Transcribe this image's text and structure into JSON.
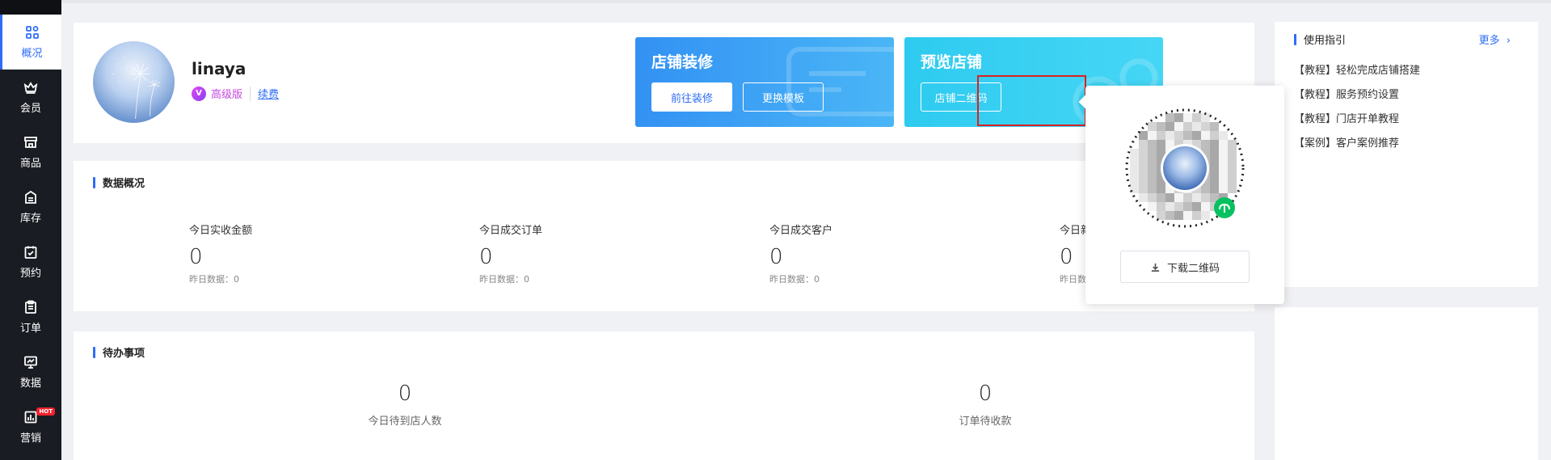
{
  "sidebar": {
    "items": [
      {
        "label": "概况",
        "icon": "overview-icon",
        "active": true
      },
      {
        "label": "会员",
        "icon": "crown-icon"
      },
      {
        "label": "商品",
        "icon": "store-icon"
      },
      {
        "label": "库存",
        "icon": "inventory-icon"
      },
      {
        "label": "预约",
        "icon": "calendar-check-icon"
      },
      {
        "label": "订单",
        "icon": "clipboard-icon"
      },
      {
        "label": "数据",
        "icon": "chart-monitor-icon"
      },
      {
        "label": "营销",
        "icon": "marketing-icon",
        "badge": "HOT"
      }
    ]
  },
  "shop": {
    "name": "linaya",
    "level_icon": "V",
    "level": "高级版",
    "renew": "续费"
  },
  "decorate": {
    "title": "店铺装修",
    "goto_btn": "前往装修",
    "template_btn": "更换模板"
  },
  "preview": {
    "title": "预览店铺",
    "qr_btn": "店铺二维码"
  },
  "overview": {
    "title": "数据概况",
    "stats": [
      {
        "label": "今日实收金额",
        "value": "0",
        "yesterday": "昨日数据：0"
      },
      {
        "label": "今日成交订单",
        "value": "0",
        "yesterday": "昨日数据：0"
      },
      {
        "label": "今日成交客户",
        "value": "0",
        "yesterday": "昨日数据：0"
      },
      {
        "label": "今日新",
        "value": "0",
        "yesterday": "昨日数据"
      }
    ]
  },
  "todo": {
    "title": "待办事项",
    "items": [
      {
        "value": "0",
        "label": "今日待到店人数"
      },
      {
        "value": "0",
        "label": "订单待收款"
      }
    ]
  },
  "guide": {
    "title": "使用指引",
    "more": "更多",
    "items": [
      "【教程】轻松完成店铺搭建",
      "【教程】服务预约设置",
      "【教程】门店开单教程",
      "【案例】客户案例推荐"
    ]
  },
  "popover": {
    "download_btn": "下载二维码"
  },
  "colors": {
    "primary": "#2f6df6",
    "sidebar_bg": "#1a1c23",
    "highlight": "#d9221f",
    "level": "#c448e0"
  }
}
